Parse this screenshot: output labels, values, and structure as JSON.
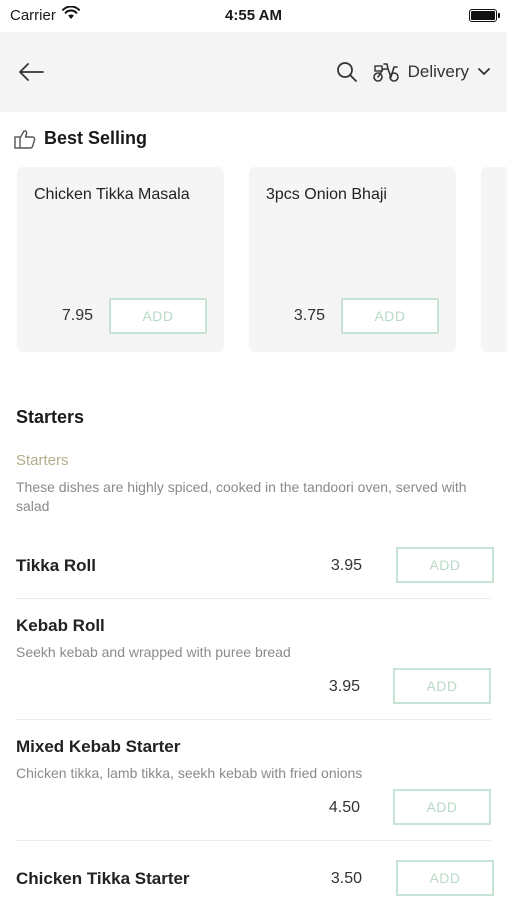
{
  "status_bar": {
    "carrier": "Carrier",
    "time": "4:55 AM"
  },
  "header": {
    "delivery_label": "Delivery"
  },
  "best_selling": {
    "title": "Best Selling",
    "items": [
      {
        "name": "Chicken Tikka Masala",
        "price": "7.95",
        "add_label": "ADD"
      },
      {
        "name": "3pcs Onion Bhaji",
        "price": "3.75",
        "add_label": "ADD"
      }
    ]
  },
  "starters": {
    "title": "Starters",
    "subtitle": "Starters",
    "description": "These dishes are highly spiced, cooked in the tandoori oven, served with salad",
    "items": [
      {
        "name": "Tikka Roll",
        "description": "",
        "price": "3.95",
        "add_label": "ADD"
      },
      {
        "name": "Kebab Roll",
        "description": "Seekh kebab and wrapped with puree bread",
        "price": "3.95",
        "add_label": "ADD"
      },
      {
        "name": "Mixed Kebab Starter",
        "description": "Chicken tikka, lamb tikka, seekh kebab with fried onions",
        "price": "4.50",
        "add_label": "ADD"
      },
      {
        "name": "Chicken Tikka Starter",
        "description": "",
        "price": "3.50",
        "add_label": "ADD"
      }
    ]
  },
  "colors": {
    "accent_border": "#c6e3d4",
    "accent_text": "#b8d9c6",
    "subtitle": "#b5ad8a",
    "header_bg": "#f4f4f4"
  },
  "icons": [
    "wifi-icon",
    "battery-icon",
    "back-arrow-icon",
    "search-icon",
    "scooter-icon",
    "chevron-down-icon",
    "thumbs-up-icon"
  ]
}
